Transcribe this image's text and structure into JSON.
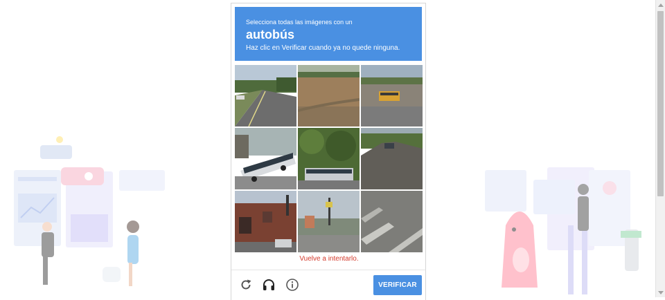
{
  "captcha": {
    "instruction_line": "Selecciona todas las imágenes con un",
    "target_word": "autobús",
    "hint_line": "Haz clic en Verificar cuando ya no quede ninguna.",
    "tiles": [
      {
        "scene": "road-with-sky"
      },
      {
        "scene": "dirt-field"
      },
      {
        "scene": "school-bus-by-wall"
      },
      {
        "scene": "city-bus-street"
      },
      {
        "scene": "bus-behind-trees"
      },
      {
        "scene": "road-with-car"
      },
      {
        "scene": "brick-building"
      },
      {
        "scene": "traffic-light-street"
      },
      {
        "scene": "road-markings"
      }
    ],
    "error_text": "Vuelve a intentarlo.",
    "verify_label": "VERIFICAR",
    "footer_icons": [
      "reload-icon",
      "headphones-icon",
      "info-icon"
    ],
    "colors": {
      "header": "#4a90e2",
      "button": "#4a90e2",
      "error": "#d33a2c"
    }
  }
}
